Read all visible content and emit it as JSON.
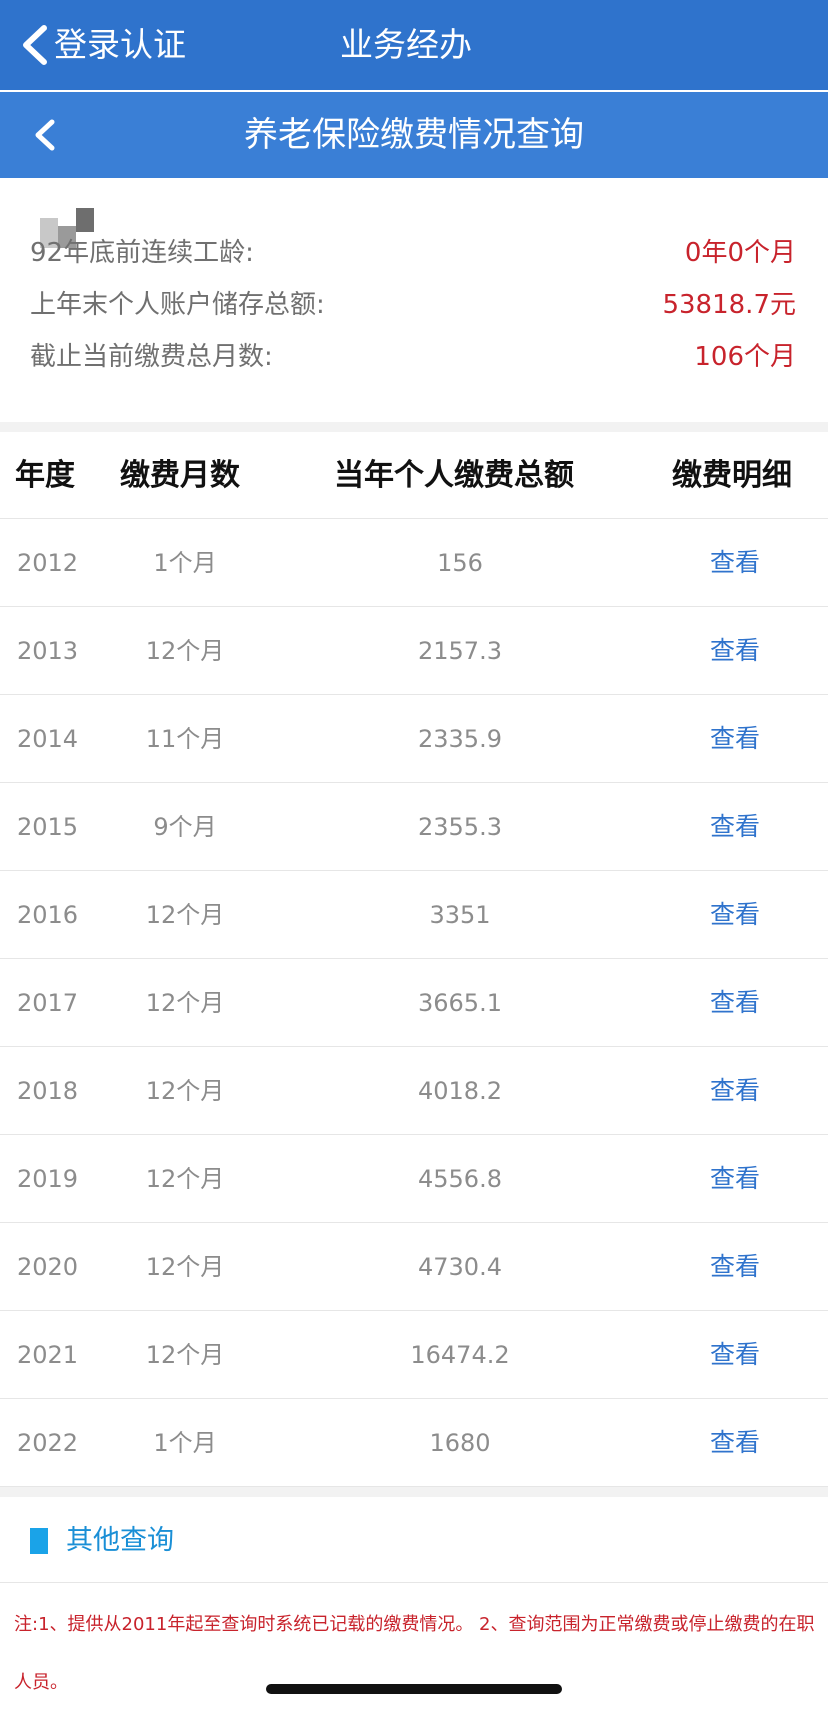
{
  "topbar": {
    "back_label": "登录认证",
    "app_title": "业务经办"
  },
  "subbar": {
    "page_title": "养老保险缴费情况查询"
  },
  "summary": {
    "items": [
      {
        "label": "92年底前连续工龄:",
        "value": "0年0个月"
      },
      {
        "label": "上年末个人账户储存总额:",
        "value": "53818.7元"
      },
      {
        "label": "截止当前缴费总月数:",
        "value": "106个月"
      }
    ]
  },
  "table": {
    "headers": {
      "year": "年度",
      "months": "缴费月数",
      "amount": "当年个人缴费总额",
      "detail": "缴费明细"
    },
    "rows": [
      {
        "year": "2012",
        "months": "1个月",
        "amount": "156",
        "link": "查看"
      },
      {
        "year": "2013",
        "months": "12个月",
        "amount": "2157.3",
        "link": "查看"
      },
      {
        "year": "2014",
        "months": "11个月",
        "amount": "2335.9",
        "link": "查看"
      },
      {
        "year": "2015",
        "months": "9个月",
        "amount": "2355.3",
        "link": "查看"
      },
      {
        "year": "2016",
        "months": "12个月",
        "amount": "3351",
        "link": "查看"
      },
      {
        "year": "2017",
        "months": "12个月",
        "amount": "3665.1",
        "link": "查看"
      },
      {
        "year": "2018",
        "months": "12个月",
        "amount": "4018.2",
        "link": "查看"
      },
      {
        "year": "2019",
        "months": "12个月",
        "amount": "4556.8",
        "link": "查看"
      },
      {
        "year": "2020",
        "months": "12个月",
        "amount": "4730.4",
        "link": "查看"
      },
      {
        "year": "2021",
        "months": "12个月",
        "amount": "16474.2",
        "link": "查看"
      },
      {
        "year": "2022",
        "months": "1个月",
        "amount": "1680",
        "link": "查看"
      }
    ]
  },
  "other_section": {
    "label": "其他查询"
  },
  "note": {
    "text": "注:1、提供从2011年起至查询时系统已记载的缴费情况。 2、查询范围为正常缴费或停止缴费的在职人员。"
  },
  "colors": {
    "header_blue": "#2f73cc",
    "subheader_blue": "#3a7fd6",
    "value_red": "#c8232c",
    "link_blue": "#2f73cc",
    "section_marker": "#1aa3e8"
  },
  "icons": {
    "back": "chevron-left-icon"
  }
}
